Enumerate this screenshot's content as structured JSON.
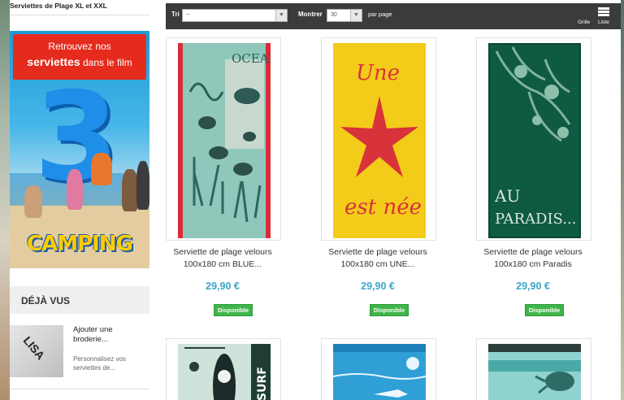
{
  "sidebar": {
    "category_title": "Serviettes de Plage XL et XXL",
    "banner": {
      "line1": "Retrouvez nos",
      "line2_bold": "serviettes",
      "line2_rest": " dans le film",
      "big_number": "3",
      "movie_title": "CAMPING"
    },
    "recently_viewed": {
      "title": "DÉJÀ VUS",
      "item": {
        "name": "Ajouter une broderie...",
        "description": "Personnalisez vos serviettes de...",
        "thumb_text": "LISA"
      }
    }
  },
  "toolbar": {
    "sort_label": "Tri",
    "sort_value": "--",
    "show_label": "Montrer",
    "show_value": "30",
    "per_page": "par page",
    "grid_label": "Grille",
    "list_label": "Liste"
  },
  "products": [
    {
      "name_line1": "Serviette de plage velours",
      "name_line2": "100x180 cm BLUE...",
      "price": "29,90 €",
      "availability": "Disponible",
      "image_text": "OCEAN"
    },
    {
      "name_line1": "Serviette de plage velours",
      "name_line2": "100x180 cm UNE...",
      "price": "29,90 €",
      "availability": "Disponible",
      "image_text_top": "Une",
      "image_text_bottom": "est née"
    },
    {
      "name_line1": "Serviette de plage velours",
      "name_line2": "100x180 cm Paradis",
      "price": "29,90 €",
      "availability": "Disponible",
      "image_text_line1": "AU",
      "image_text_line2": "PARADIS..."
    }
  ],
  "row2": {
    "surf_text": "SURF"
  },
  "colors": {
    "toolbar_bg": "#3b3b3b",
    "price": "#3ba6c8",
    "available_badge": "#3fb44a",
    "banner_red": "#e42b1e"
  }
}
